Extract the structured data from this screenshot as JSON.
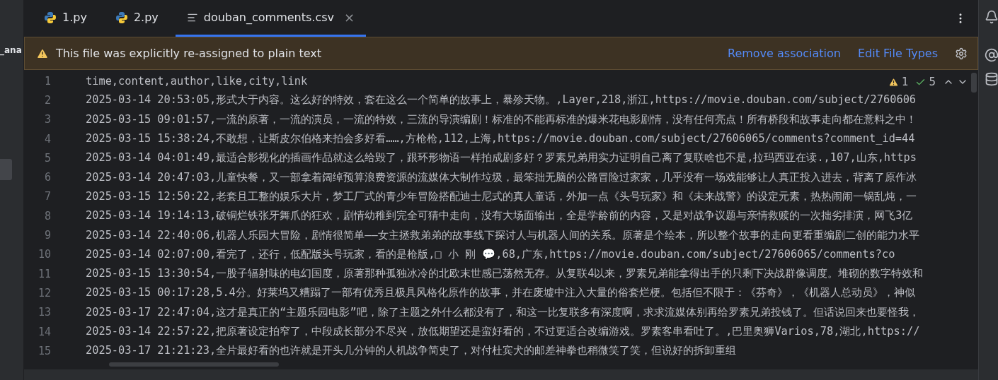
{
  "sidebar": {
    "label": "_ana"
  },
  "tabs": [
    {
      "label": "1.py",
      "kind": "python",
      "selected": false
    },
    {
      "label": "2.py",
      "kind": "python",
      "selected": false
    },
    {
      "label": "douban_comments.csv",
      "kind": "text",
      "selected": true,
      "close": "×"
    }
  ],
  "banner": {
    "message": "This file was explicitly re-assigned to plain text",
    "actions": [
      "Remove association",
      "Edit File Types"
    ]
  },
  "inspections": {
    "warnings": "1",
    "passed": "5"
  },
  "editor": {
    "lines": [
      {
        "number": "1",
        "text": "time,content,author,like,city,link"
      },
      {
        "number": "2",
        "text": "2025-03-14 20:53:05,形式大于内容。这么好的特效，套在这么一个简单的故事上，暴殄天物。,Layer,218,浙江,https://movie.douban.com/subject/2760606"
      },
      {
        "number": "3",
        "text": "2025-03-15 09:01:57,一流的原著，一流的演员，一流的特效，三流的导演编剧！标准的不能再标准的爆米花电影剧情，没有任何亮点！所有桥段和故事走向都在意料之中！"
      },
      {
        "number": "4",
        "text": "2025-03-15 15:38:24,不敢想，让斯皮尔伯格来拍会多好看……,方枪枪,112,上海,https://movie.douban.com/subject/27606065/comments?comment_id=44"
      },
      {
        "number": "5",
        "text": "2025-03-14 04:01:49,最适合影视化的插画作品就这么给毁了，跟环形物语一样拍成剧多好？罗素兄弟用实力证明自己离了复联啥也不是,拉玛西亚在读.,107,山东,https"
      },
      {
        "number": "6",
        "text": "2025-03-14 20:47:03,儿童快餐，又一部拿着阔绰预算浪费资源的流媒体大制作垃圾，最笨拙无脑的公路冒险过家家，几乎没有一场戏能够让人真正投入进去，背离了原作冰"
      },
      {
        "number": "7",
        "text": "2025-03-15 12:50:22,老套且工整的娱乐大片，梦工厂式的青少年冒险搭配迪士尼式的真人童话，外加一点《头号玩家》和《未来战警》的设定元素，热热闹闹一锅乱炖，一"
      },
      {
        "number": "8",
        "text": "2025-03-14 19:14:13,破铜烂铁张牙舞爪的狂欢，剧情幼稚到完全可猜中走向，没有大场面输出，全是学龄前的内容，又是对战争议题与亲情救赎的一次拙劣排演，网飞3亿"
      },
      {
        "number": "9",
        "text": "2025-03-14 22:40:06,机器人乐园大冒险，剧情很简单——女主拯救弟弟的故事线下探讨人与机器人间的关系。原著是个绘本，所以整个故事的走向更看重编剧二创的能力水平"
      },
      {
        "number": "10",
        "text": "2025-03-14 02:07:00,看完了，还行，低配版头号玩家，看的是枪版,□ 小  刚  💬,68,广东,https://movie.douban.com/subject/27606065/comments?co"
      },
      {
        "number": "11",
        "text": "2025-03-15 13:30:54,一股子辐射味的电幻国度，原著那种孤独冰冷的北欧末世感已荡然无存。从复联4以来，罗素兄弟能拿得出手的只剩下决战群像调度。堆砌的数字特效和"
      },
      {
        "number": "12",
        "text": "2025-03-15 00:17:28,5.4分。好莱坞又糟蹋了一部有优秀且极具风格化原作的故事，并在废墟中注入大量的俗套烂梗。包括但不限于：《芬奇》，《机器人总动员》，神似"
      },
      {
        "number": "13",
        "text": "2025-03-17 22:47:04,这才是真正的“主题乐园电影”吧，除了主题之外什么都没有了，和这一比复联多有深度啊，求求流媒体别再给罗素兄弟投钱了。但话说回来也要怪我，"
      },
      {
        "number": "14",
        "text": "2025-03-14 22:57:22,把原著设定拍窄了，中段成长部分不尽兴，放低期望还是蛮好看的，不过更适合改编游戏。罗素客串看吐了。,巴里奥狮Varios,78,湖北,https://"
      },
      {
        "number": "15",
        "text": "2025-03-17 21:21:23,全片最好看的也许就是开头几分钟的人机战争简史了，对付杜宾犬的邮差神拳也稍微笑了笑，但说好的拆卸重组"
      }
    ]
  }
}
